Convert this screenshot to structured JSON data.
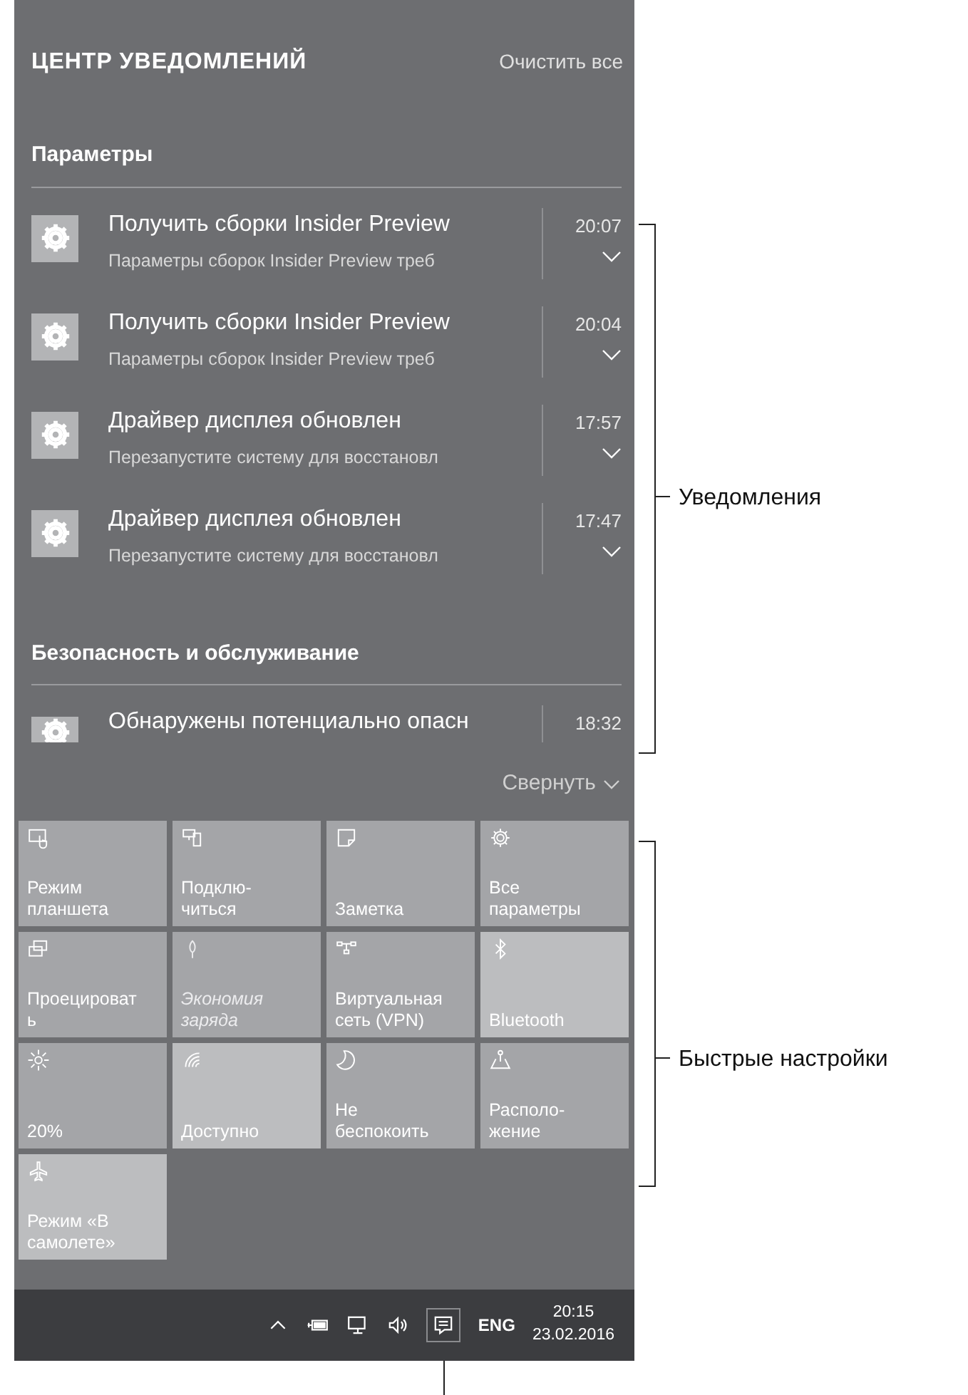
{
  "header": {
    "title": "ЦЕНТР УВЕДОМЛЕНИЙ",
    "clear_all": "Очистить все"
  },
  "groups": [
    {
      "name": "Параметры",
      "items": [
        {
          "title": "Получить сборки Insider Preview",
          "body": "Параметры сборок Insider Preview треб",
          "time": "20:07",
          "expandable": true
        },
        {
          "title": "Получить сборки Insider Preview",
          "body": "Параметры сборок Insider Preview треб",
          "time": "20:04",
          "expandable": true
        },
        {
          "title": "Драйвер дисплея обновлен",
          "body": "Перезапустите систему для восстановл",
          "time": "17:57",
          "expandable": true
        },
        {
          "title": "Драйвер дисплея обновлен",
          "body": "Перезапустите систему для восстановл",
          "time": "17:47",
          "expandable": true
        }
      ]
    },
    {
      "name": "Безопасность и обслуживание",
      "items": [
        {
          "title": "Обнаружены потенциально опасн",
          "time": "18:32",
          "expandable": false
        }
      ]
    }
  ],
  "collapse": "Свернуть",
  "tiles": [
    {
      "kind": "tablet",
      "label": "Режим\nпланшета",
      "on": false,
      "disabled": false
    },
    {
      "kind": "connect",
      "label": "Подклю-\nчиться",
      "on": false,
      "disabled": false
    },
    {
      "kind": "note",
      "label": "Заметка",
      "on": false,
      "disabled": false
    },
    {
      "kind": "settings",
      "label": "Все\nпараметры",
      "on": false,
      "disabled": false
    },
    {
      "kind": "project",
      "label": "Проецироват\nь",
      "on": false,
      "disabled": false
    },
    {
      "kind": "battery",
      "label": "Экономия\nзаряда",
      "on": false,
      "disabled": true
    },
    {
      "kind": "vpn",
      "label": "Виртуальная\nсеть (VPN)",
      "on": false,
      "disabled": false
    },
    {
      "kind": "bluetooth",
      "label": "Bluetooth",
      "on": true,
      "disabled": false
    },
    {
      "kind": "brightness",
      "label": "20%",
      "on": false,
      "disabled": false
    },
    {
      "kind": "wifi",
      "label": "Доступно",
      "on": true,
      "disabled": false
    },
    {
      "kind": "moon",
      "label": "Не\nбеспокоить",
      "on": false,
      "disabled": false
    },
    {
      "kind": "location",
      "label": "Располо-\nжение",
      "on": false,
      "disabled": false
    },
    {
      "kind": "airplane",
      "label": "Режим «В\nсамолете»",
      "on": true,
      "disabled": false
    }
  ],
  "taskbar": {
    "language": "ENG",
    "time": "20:15",
    "date": "23.02.2016"
  },
  "callouts": [
    "Уведомления",
    "Быстрые настройки"
  ]
}
